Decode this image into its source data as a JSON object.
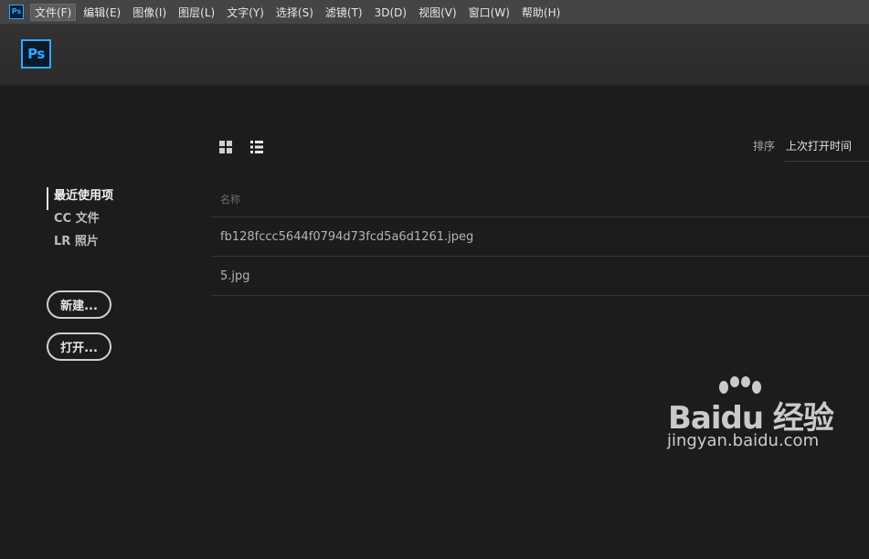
{
  "menubar": {
    "app_icon": "Ps",
    "items": [
      "文件(F)",
      "编辑(E)",
      "图像(I)",
      "图层(L)",
      "文字(Y)",
      "选择(S)",
      "滤镜(T)",
      "3D(D)",
      "视图(V)",
      "窗口(W)",
      "帮助(H)"
    ]
  },
  "header": {
    "logo": "Ps"
  },
  "nav": {
    "items": [
      "最近使用项",
      "CC 文件",
      "LR 照片"
    ]
  },
  "buttons": {
    "new": "新建...",
    "open": "打开..."
  },
  "sort": {
    "label": "排序",
    "value": "上次打开时间"
  },
  "table": {
    "header": "名称",
    "rows": [
      "fb128fccc5644f0794d73fcd5a6d1261.jpeg",
      "5.jpg"
    ]
  },
  "watermark": {
    "logo": "Baidu 经验",
    "url": "jingyan.baidu.com"
  },
  "colors": {
    "accent": "#31a8ff",
    "background": "#1c1c1c",
    "menubar": "#454545"
  }
}
